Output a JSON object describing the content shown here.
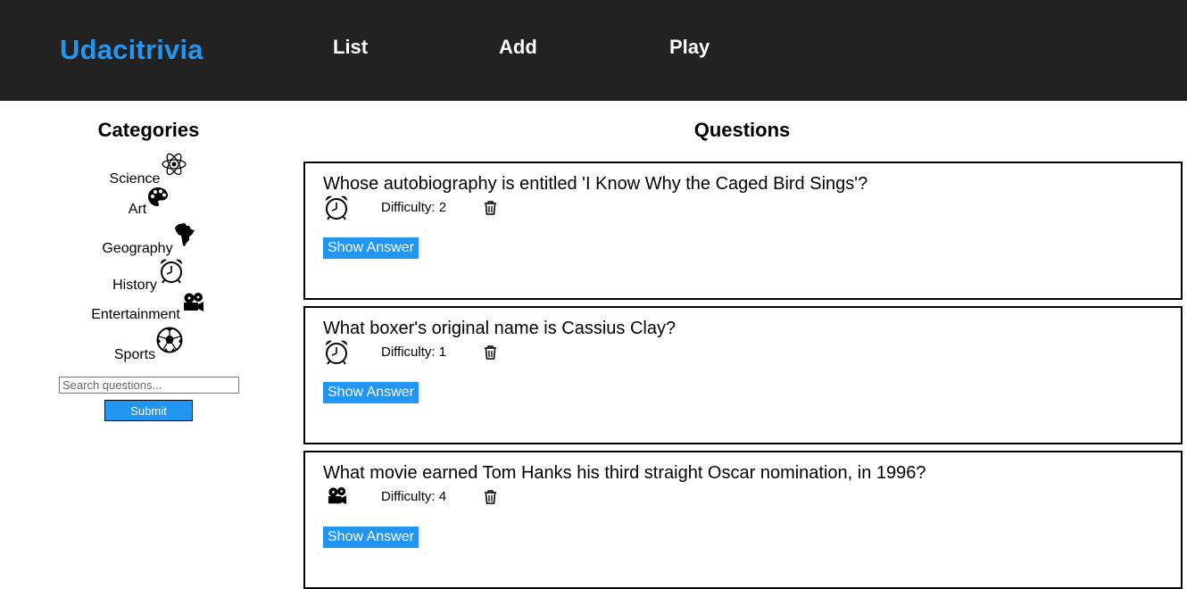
{
  "header": {
    "logo": "Udacitrivia",
    "nav": [
      {
        "label": "List"
      },
      {
        "label": "Add"
      },
      {
        "label": "Play"
      }
    ]
  },
  "sidebar": {
    "title": "Categories",
    "categories": [
      {
        "label": "Science",
        "icon": "science-icon"
      },
      {
        "label": "Art",
        "icon": "art-palette-icon"
      },
      {
        "label": "Geography",
        "icon": "africa-map-icon"
      },
      {
        "label": "History",
        "icon": "alarm-clock-icon"
      },
      {
        "label": "Entertainment",
        "icon": "film-camera-icon"
      },
      {
        "label": "Sports",
        "icon": "soccer-ball-icon"
      }
    ],
    "search": {
      "placeholder": "Search questions...",
      "value": ""
    },
    "submit_label": "Submit"
  },
  "main": {
    "title": "Questions",
    "questions": [
      {
        "text": "Whose autobiography is entitled 'I Know Why the Caged Bird Sings'?",
        "category_icon": "alarm-clock-icon",
        "difficulty": "Difficulty: 2",
        "show_answer_label": "Show Answer"
      },
      {
        "text": "What boxer's original name is Cassius Clay?",
        "category_icon": "alarm-clock-icon",
        "difficulty": "Difficulty: 1",
        "show_answer_label": "Show Answer"
      },
      {
        "text": "What movie earned Tom Hanks his third straight Oscar nomination, in 1996?",
        "category_icon": "film-camera-icon",
        "difficulty": "Difficulty: 4",
        "show_answer_label": "Show Answer"
      }
    ]
  },
  "colors": {
    "header_bg": "#222222",
    "accent": "#2196f3"
  }
}
